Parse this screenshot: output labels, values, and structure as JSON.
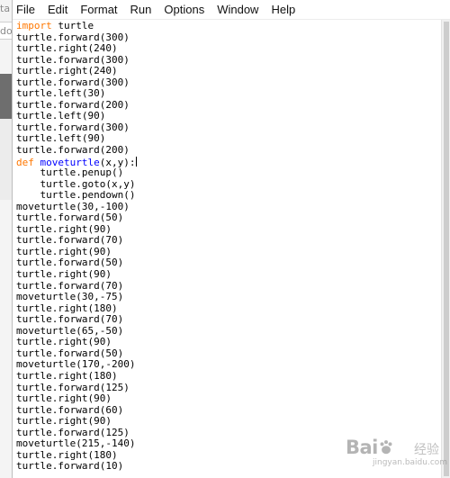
{
  "background_window": {
    "fragment_top": "ta",
    "fragment_field": "do"
  },
  "menubar": {
    "items": [
      "File",
      "Edit",
      "Format",
      "Run",
      "Options",
      "Window",
      "Help"
    ]
  },
  "code": {
    "lines": [
      "import turtle",
      "turtle.forward(300)",
      "turtle.right(240)",
      "turtle.forward(300)",
      "turtle.right(240)",
      "turtle.forward(300)",
      "turtle.left(30)",
      "turtle.forward(200)",
      "turtle.left(90)",
      "turtle.forward(300)",
      "turtle.left(90)",
      "turtle.forward(200)",
      "def moveturtle(x,y):",
      "    turtle.penup()",
      "    turtle.goto(x,y)",
      "    turtle.pendown()",
      "moveturtle(30,-100)",
      "turtle.forward(50)",
      "turtle.right(90)",
      "turtle.forward(70)",
      "turtle.right(90)",
      "turtle.forward(50)",
      "turtle.right(90)",
      "turtle.forward(70)",
      "moveturtle(30,-75)",
      "turtle.right(180)",
      "turtle.forward(70)",
      "moveturtle(65,-50)",
      "turtle.right(90)",
      "turtle.forward(50)",
      "moveturtle(170,-200)",
      "turtle.right(180)",
      "turtle.forward(125)",
      "turtle.right(90)",
      "turtle.forward(60)",
      "turtle.right(90)",
      "turtle.forward(125)",
      "moveturtle(215,-140)",
      "turtle.right(180)",
      "turtle.forward(10)"
    ]
  },
  "syntax_colors": {
    "keyword": "#ff7700",
    "definition": "#0000ff",
    "text": "#000000"
  },
  "watermark": {
    "logo_text": "Bai",
    "logo_suffix": "经验",
    "sub_text": "jingyan.baidu.com"
  }
}
